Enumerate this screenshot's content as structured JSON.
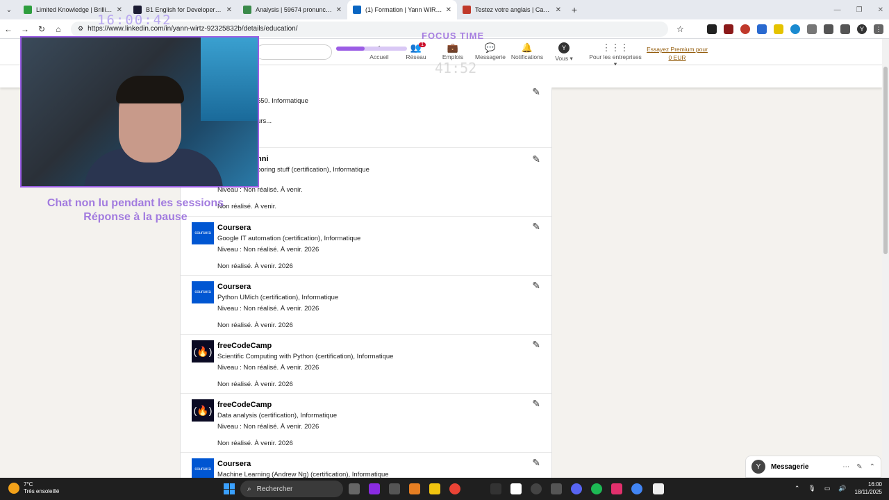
{
  "browser": {
    "tabs": [
      {
        "title": "Limited Knowledge | Brilliant",
        "color": "#2e9e3e"
      },
      {
        "title": "B1 English for Developers Certi",
        "color": "#1b1b32"
      },
      {
        "title": "Analysis | 59674 pronunciation",
        "color": "#3a8a4a"
      },
      {
        "title": "(1) Formation | Yann WIRTZ | Li",
        "color": "#0a66c2",
        "active": true
      },
      {
        "title": "Testez votre anglais | Cambridg",
        "color": "#c0392b"
      }
    ],
    "url": "https://www.linkedin.com/in/yann-wirtz-92325832b/details/education/"
  },
  "linkedin": {
    "nav": {
      "home": "Accueil",
      "network": "Réseau",
      "network_badge": "1",
      "jobs": "Emplois",
      "messaging": "Messagerie",
      "notifications": "Notifications",
      "me": "Vous",
      "business": "Pour les entreprises",
      "premium_line1": "Essayez Premium pour",
      "premium_line2": "0 EUR"
    },
    "entries": [
      {
        "partial_line1": "550. Informatique",
        "partial_line2": "urs..."
      },
      {
        "name_partial": "nni",
        "line1_partial": "boring stuff (certification), Informatique",
        "line2": "Niveau : Non réalisé. À venir.",
        "line3": "Non réalisé. À venir."
      },
      {
        "name": "Coursera",
        "logo": "coursera",
        "line1": "Google IT automation (certification), Informatique",
        "line2": "Niveau : Non réalisé. À venir. 2026",
        "line3": "Non réalisé. À venir. 2026"
      },
      {
        "name": "Coursera",
        "logo": "coursera",
        "line1": "Python UMich (certification), Informatique",
        "line2": "Niveau : Non réalisé. À venir. 2026",
        "line3": "Non réalisé. À venir. 2026"
      },
      {
        "name": "freeCodeCamp",
        "logo": "fcc",
        "line1": "Scientific Computing with Python (certification), Informatique",
        "line2": "Niveau : Non réalisé. À venir. 2026",
        "line3": "Non réalisé. À venir. 2026"
      },
      {
        "name": "freeCodeCamp",
        "logo": "fcc",
        "line1": "Data analysis (certification), Informatique",
        "line2": "Niveau : Non réalisé. À venir. 2026",
        "line3": "Non réalisé. À venir. 2026"
      },
      {
        "name": "Coursera",
        "logo": "coursera",
        "line1": "Machine Learning (Andrew Ng) (certification), Informatique"
      }
    ],
    "logo_text": "coursera",
    "messaging_panel": {
      "avatar": "Y",
      "label": "Messagerie"
    }
  },
  "overlay": {
    "clock": "16:00:42",
    "focus_label": "FOCUS TIME",
    "focus_remaining": "41:52",
    "focus_progress": 0.4,
    "chat_line1": "Chat non lu pendant les sessions",
    "chat_line2": "Réponse à la pause"
  },
  "taskbar": {
    "temp": "7°C",
    "weather": "Très ensoleillé",
    "search_placeholder": "Rechercher",
    "time": "16:00",
    "date": "18/11/2025"
  }
}
